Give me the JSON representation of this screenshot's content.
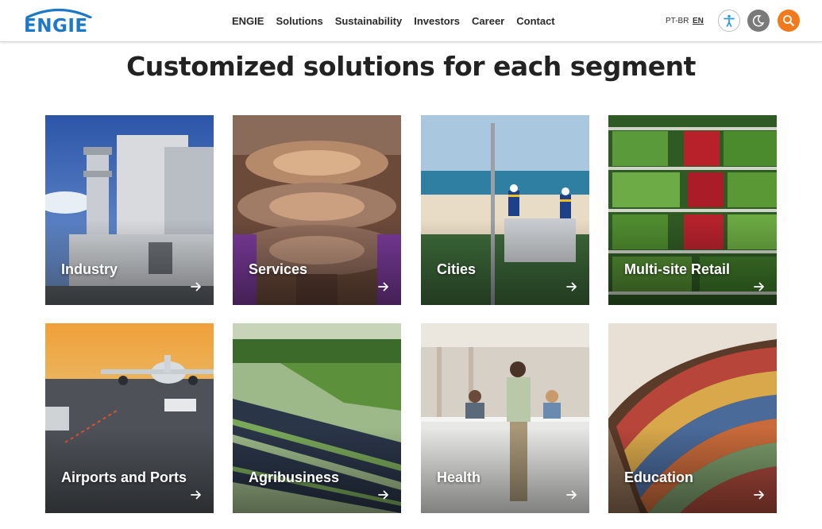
{
  "header": {
    "logo_text": "ENGIE",
    "logo_alt": "ENGIE",
    "nav": [
      "ENGIE",
      "Solutions",
      "Sustainability",
      "Investors",
      "Career",
      "Contact"
    ],
    "lang_pt": "PT-BR",
    "lang_en": "EN",
    "icons": [
      "accessibility-icon",
      "dark-mode-icon",
      "search-icon"
    ]
  },
  "main": {
    "title": "Customized solutions for each segment",
    "cards": [
      {
        "label": "Industry",
        "icon": "arrow-right-icon"
      },
      {
        "label": "Services",
        "icon": "arrow-right-icon"
      },
      {
        "label": "Cities",
        "icon": "arrow-right-icon"
      },
      {
        "label": "Multi-site Retail",
        "icon": "arrow-right-icon"
      },
      {
        "label": "Airports and Ports",
        "icon": "arrow-right-icon"
      },
      {
        "label": "Agribusiness",
        "icon": "arrow-right-icon"
      },
      {
        "label": "Health",
        "icon": "arrow-right-icon"
      },
      {
        "label": "Education",
        "icon": "arrow-right-icon"
      }
    ]
  },
  "colors": {
    "brand_blue": "#1d78c7",
    "search_orange": "#f07a1c",
    "title_text": "#222222"
  }
}
